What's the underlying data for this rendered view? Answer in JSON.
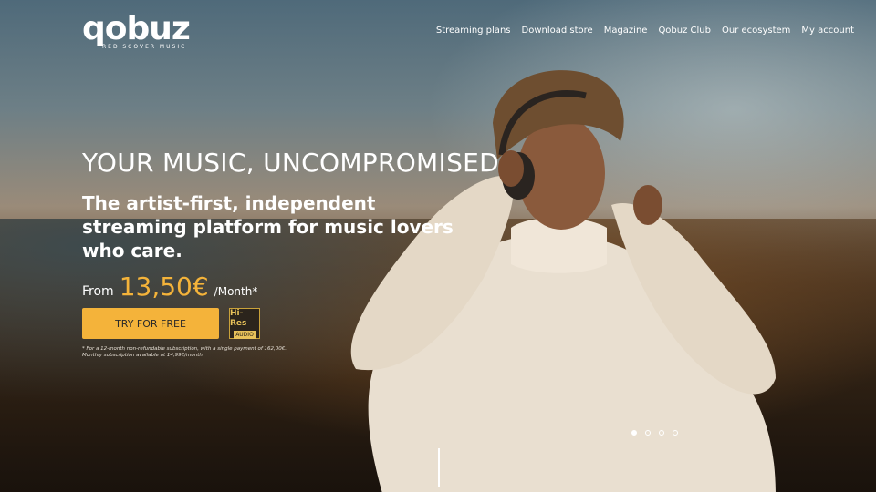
{
  "brand": {
    "name": "qobuz",
    "tagline": "REDISCOVER MUSIC"
  },
  "nav": {
    "items": [
      "Streaming plans",
      "Download store",
      "Magazine",
      "Qobuz Club",
      "Our ecosystem",
      "My account"
    ]
  },
  "hero": {
    "headline": "YOUR MUSIC, UNCOMPROMISED",
    "subhead": "The artist-first, independent streaming platform for music lovers who care.",
    "price_from": "From",
    "price_amount": "13,50€",
    "price_period": "/Month*",
    "cta_label": "TRY FOR FREE",
    "badge_top": "Hi-Res",
    "badge_bottom": "AUDIO",
    "footnote": "* For a 12-month non-refundable subscription, with a single payment of 162,00€. Monthly subscription available at 14,99€/month."
  },
  "carousel": {
    "slide_count": 4,
    "active_index": 0
  },
  "colors": {
    "accent": "#f4b33a"
  }
}
